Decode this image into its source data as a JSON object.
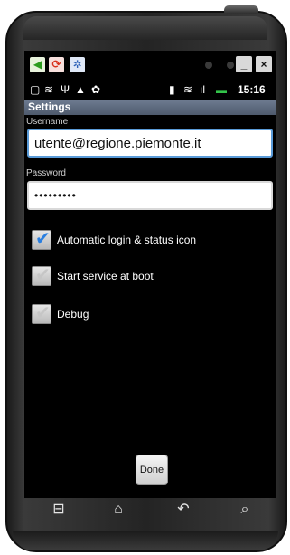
{
  "emulator": {
    "icons": [
      "back-arrow-icon",
      "forward-icon",
      "gear-icon"
    ],
    "minimize_glyph": "_",
    "close_glyph": "×"
  },
  "status_bar": {
    "icons": [
      "notification-icon",
      "wifi-icon",
      "usb-icon",
      "warning-icon",
      "android-icon",
      "vibrate-icon",
      "wifi-icon",
      "signal-icon",
      "battery-icon"
    ],
    "time": "15:16"
  },
  "app": {
    "title": "Settings",
    "username_label": "Username",
    "username_value": "utente@regione.piemonte.it",
    "password_label": "Password",
    "password_value": "•••••••••"
  },
  "options": [
    {
      "label": "Automatic login & status icon",
      "checked": true
    },
    {
      "label": "Start service at boot",
      "checked": false
    },
    {
      "label": "Debug",
      "checked": false
    }
  ],
  "done_label": "Done",
  "nav_keys": [
    "menu-icon",
    "home-icon",
    "back-icon",
    "search-icon"
  ],
  "colors": {
    "title_bar": "#5f6b7e",
    "focus_border": "#5a9bd8",
    "check_blue": "#2a7fe0"
  }
}
